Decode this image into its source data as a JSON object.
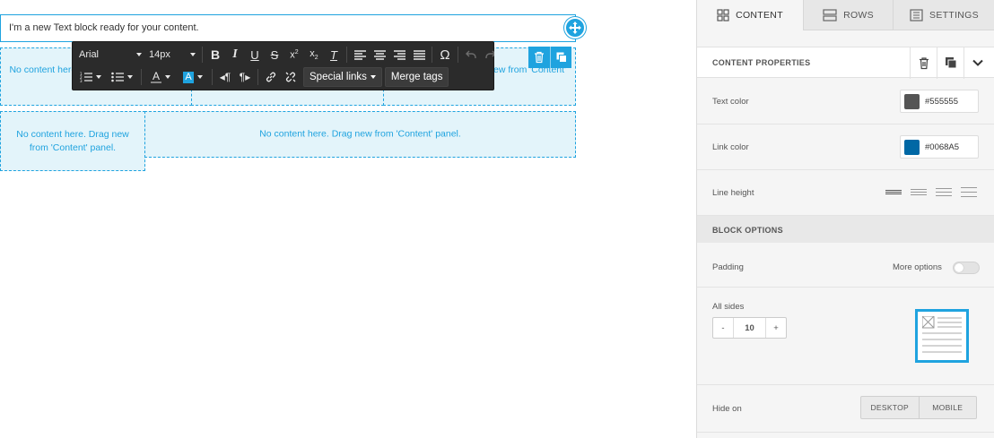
{
  "canvas": {
    "text_block": "I'm a new Text block ready for your content.",
    "drop_zones": {
      "dz1": "No content here. Drag new from 'Content' panel.",
      "dz3": "No content here. Drag new from 'Content' panel.",
      "dz4": "No content here. Drag new from 'Content' panel.",
      "dz5": "No content here. Drag new from 'Content' panel."
    }
  },
  "toolbar": {
    "font_family": "Arial",
    "font_size": "14px",
    "special_links": "Special links",
    "merge_tags": "Merge tags"
  },
  "tabs": {
    "content": "CONTENT",
    "rows": "ROWS",
    "settings": "SETTINGS"
  },
  "panel": {
    "content_properties": "CONTENT PROPERTIES",
    "text_color_label": "Text color",
    "text_color": "#555555",
    "link_color_label": "Link color",
    "link_color": "#0068A5",
    "line_height_label": "Line height",
    "block_options": "BLOCK OPTIONS",
    "padding_label": "Padding",
    "more_options": "More options",
    "all_sides": "All sides",
    "padding_minus": "-",
    "padding_value": "10",
    "padding_plus": "+",
    "hide_on": "Hide on",
    "desktop": "DESKTOP",
    "mobile": "MOBILE"
  },
  "colors": {
    "accent": "#1fa3df",
    "text_color_swatch": "#555555",
    "link_color_swatch": "#0068A5"
  }
}
